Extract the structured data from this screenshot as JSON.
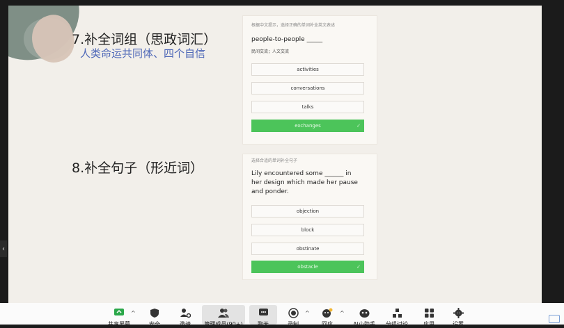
{
  "slide": {
    "q7_heading": "7.补全词组（思政词汇）",
    "q7_subheading": "人类命运共同体、四个自信",
    "q8_heading": "8.补全句子（形近词）"
  },
  "card1": {
    "instruction": "根据中文提示，选择正确的单词补全英文表述",
    "prompt": "people-to-people _____",
    "hint": "民间交流；人文交流",
    "options": [
      "activities",
      "conversations",
      "talks",
      "exchanges"
    ],
    "selected_index": 3
  },
  "card2": {
    "instruction": "选择合适的单词补全句子",
    "prompt": "Lily encountered some ______ in her design which made her pause and ponder.",
    "options": [
      "objection",
      "block",
      "obstinate",
      "obstacle"
    ],
    "selected_index": 3
  },
  "side": {
    "arrow": "‹"
  },
  "toolbar": {
    "share_screen": "共享屏幕",
    "security": "安全",
    "invite": "邀请",
    "participants": "管理成员(90+)",
    "chat": "聊天",
    "record": "录制",
    "reactions": "回应",
    "ai_assistant": "AI小助手",
    "breakout": "分组讨论",
    "apps": "应用",
    "settings": "设置",
    "caret": "^"
  },
  "colors": {
    "selected_option": "#4cc45a",
    "subheading": "#4f68b8",
    "slide_bg": "#f2efea"
  }
}
